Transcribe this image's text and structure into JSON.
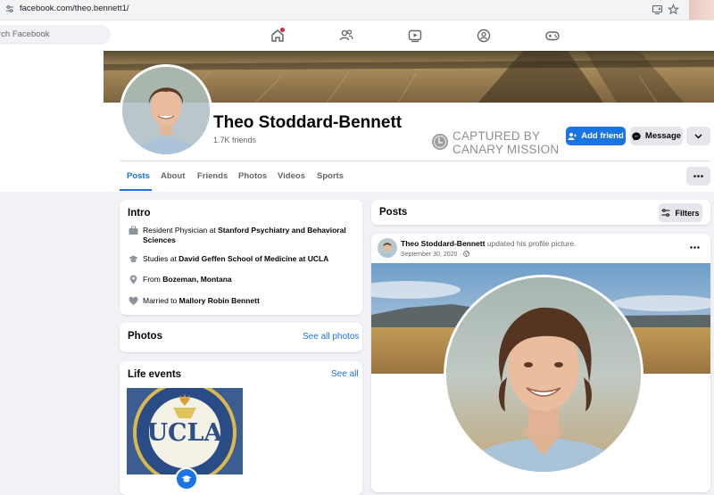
{
  "browser": {
    "url": "facebook.com/theo.bennett1/"
  },
  "nav": {
    "search_placeholder": "Search Facebook",
    "search_visible": "rch Facebook"
  },
  "profile": {
    "name": "Theo Stoddard-Bennett",
    "friends": "1.7K friends",
    "watermark_line1": "CAPTURED BY",
    "watermark_line2": "CANARY MISSION",
    "add_friend": "Add friend",
    "message": "Message"
  },
  "tabs": [
    {
      "label": "Posts",
      "active": true
    },
    {
      "label": "About"
    },
    {
      "label": "Friends"
    },
    {
      "label": "Photos"
    },
    {
      "label": "Videos"
    },
    {
      "label": "Sports"
    }
  ],
  "intro": {
    "title": "Intro",
    "work_prefix": "Resident Physician at ",
    "work_place": "Stanford Psychiatry and Behavioral Sciences",
    "study_prefix": "Studies at ",
    "study_place": "David Geffen School of Medicine at UCLA",
    "from_prefix": "From ",
    "from_place": "Bozeman, Montana",
    "married_prefix": "Married to ",
    "married_name": "Mallory Robin Bennett"
  },
  "photos": {
    "title": "Photos",
    "see_all": "See all photos"
  },
  "life_events": {
    "title": "Life events",
    "see_all": "See all",
    "seal_text": "UCLA",
    "seal_ring": "DAVID GEFFEN SCHOOL OF MEDICINE"
  },
  "posts": {
    "title": "Posts",
    "filters": "Filters",
    "author": "Theo Stoddard-Bennett",
    "action": " updated his profile picture.",
    "date": "September 30, 2020 · "
  },
  "colors": {
    "fb_blue": "#1b74e4",
    "background": "#f0f2f5",
    "muted": "#65676b"
  }
}
